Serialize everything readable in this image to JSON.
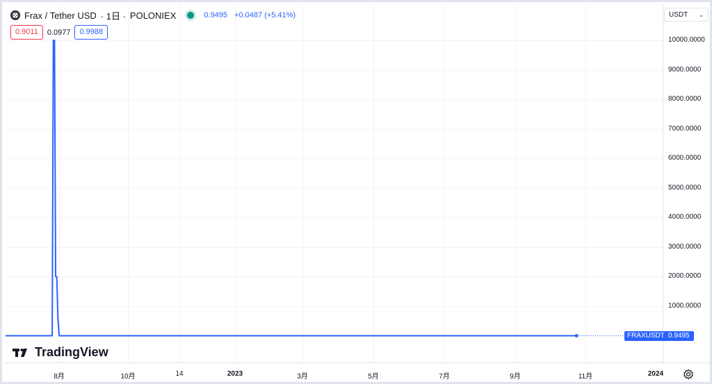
{
  "header": {
    "title": "Frax / Tether USD",
    "interval": "· 1日 ·",
    "exchange": "POLONIEX",
    "last_price": "0.9495",
    "change": "+0.0487 (+5.41%)"
  },
  "ohlc": {
    "bid": "0.9011",
    "spread": "0.0977",
    "ask": "0.9988"
  },
  "currency": {
    "label": "USDT"
  },
  "price_axis": [
    "10000.0000",
    "9000.0000",
    "8000.0000",
    "7000.0000",
    "6000.0000",
    "5000.0000",
    "4000.0000",
    "3000.0000",
    "2000.0000",
    "1000.0000"
  ],
  "time_axis": [
    {
      "label": "8月",
      "bold": false
    },
    {
      "label": "10月",
      "bold": false
    },
    {
      "label": "14",
      "bold": false
    },
    {
      "label": "2023",
      "bold": true
    },
    {
      "label": "3月",
      "bold": false
    },
    {
      "label": "5月",
      "bold": false
    },
    {
      "label": "7月",
      "bold": false
    },
    {
      "label": "9月",
      "bold": false
    },
    {
      "label": "11月",
      "bold": false
    },
    {
      "label": "2024",
      "bold": true
    }
  ],
  "symbol_tag": "FRAXUSDT",
  "last_tag": "0.9495",
  "brand": "TradingView",
  "colors": {
    "line": "#2962ff",
    "up": "#089981",
    "down": "#f23645"
  },
  "chart_data": {
    "type": "line",
    "series": [
      {
        "values": [
          {
            "x": "2022-07-26",
            "y": 0.95
          },
          {
            "x": "2022-07-27",
            "y": 10000
          },
          {
            "x": "2022-07-28",
            "y": 10000
          },
          {
            "x": "2022-07-29",
            "y": 2000
          },
          {
            "x": "2022-07-30",
            "y": 2000
          },
          {
            "x": "2022-07-31",
            "y": 600
          },
          {
            "x": "2022-08-01",
            "y": 0.99
          },
          {
            "x": "2023-10-25",
            "y": 0.9495
          }
        ]
      }
    ],
    "ylim": [
      0,
      10000
    ],
    "grid": true
  }
}
